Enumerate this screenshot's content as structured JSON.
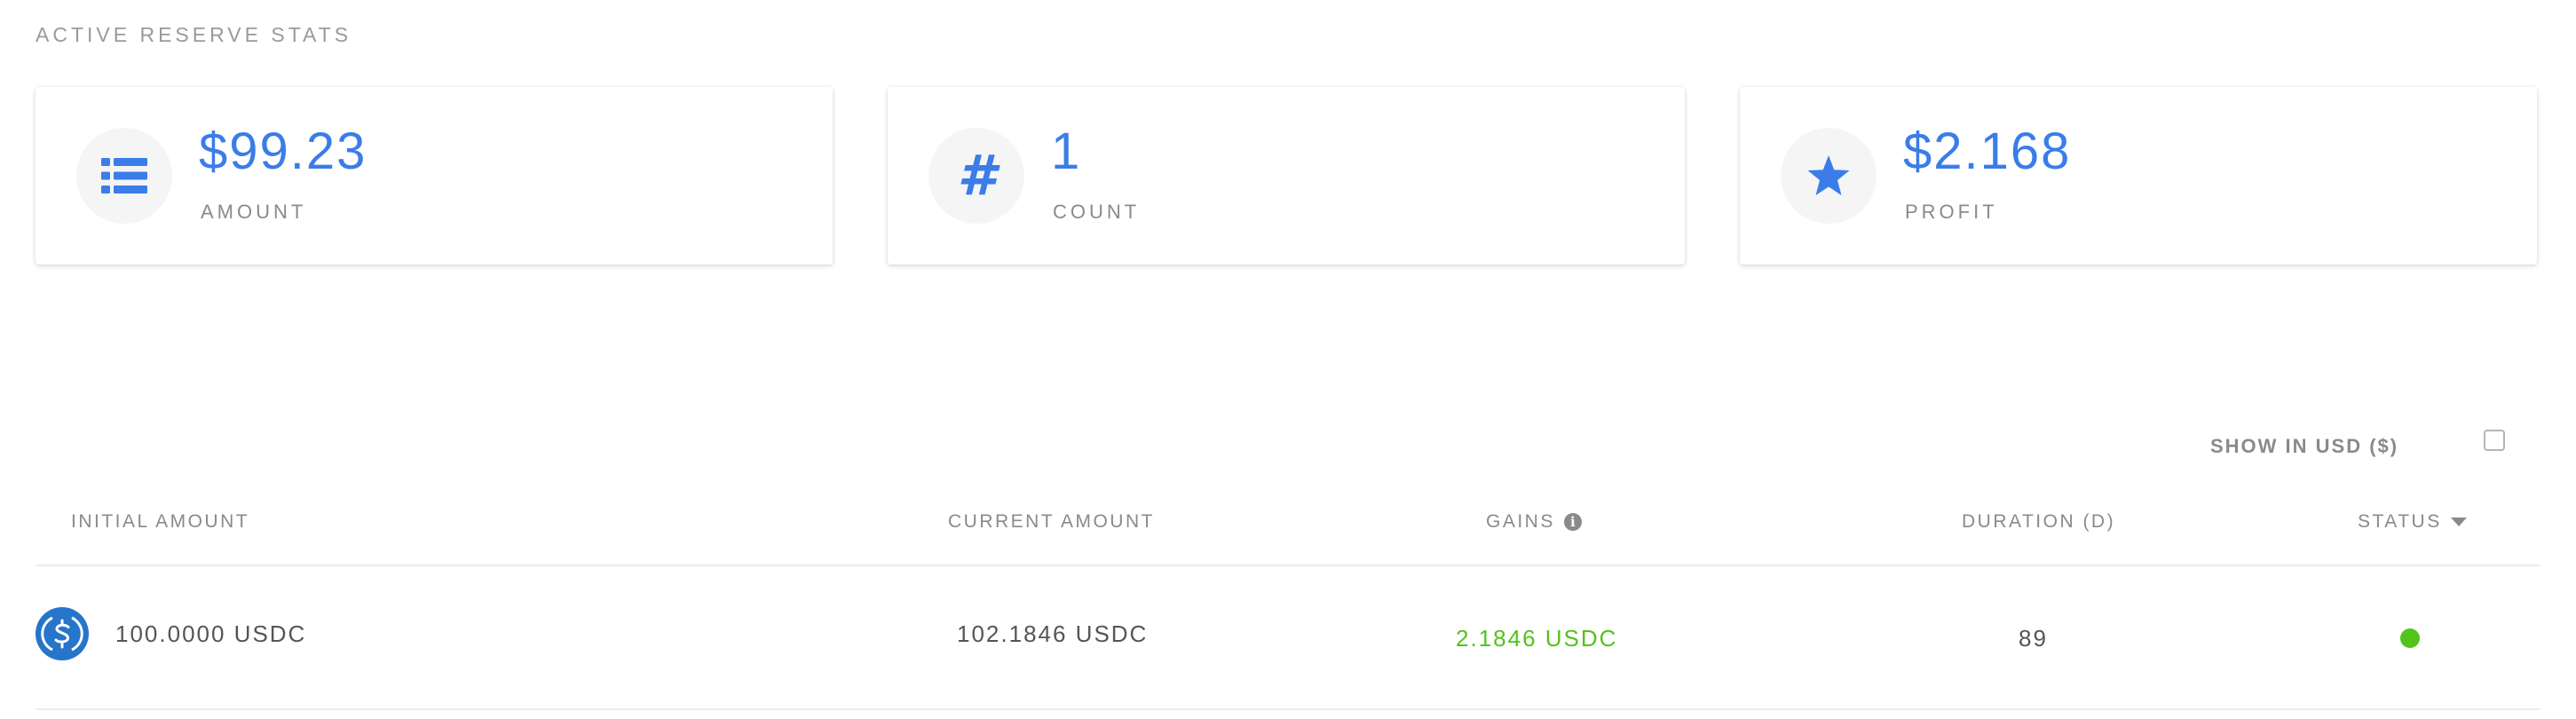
{
  "stats": {
    "title": "ACTIVE RESERVE STATS",
    "cards": [
      {
        "icon": "list-icon",
        "value": "$99.23",
        "label": "AMOUNT"
      },
      {
        "icon": "hash-icon",
        "value": "1",
        "label": "COUNT"
      },
      {
        "icon": "star-icon",
        "value": "$2.168",
        "label": "PROFIT"
      }
    ]
  },
  "hash_glyph": "#",
  "toggle": {
    "label": "SHOW IN USD ($)",
    "checked": false
  },
  "table": {
    "headers": {
      "initial_amount": "INITIAL AMOUNT",
      "current_amount": "CURRENT AMOUNT",
      "gains": "GAINS",
      "duration": "DURATION (D)",
      "status": "STATUS"
    },
    "rows": [
      {
        "coin_icon": "usdc-icon",
        "initial_amount": "100.0000 USDC",
        "current_amount": "102.1846 USDC",
        "gains": "2.1846 USDC",
        "duration": "89",
        "status": "active"
      }
    ]
  },
  "colors": {
    "accent": "#3a7de9",
    "gain": "#52c41a",
    "status_active": "#52c41a",
    "usdc": "#2775ca"
  }
}
